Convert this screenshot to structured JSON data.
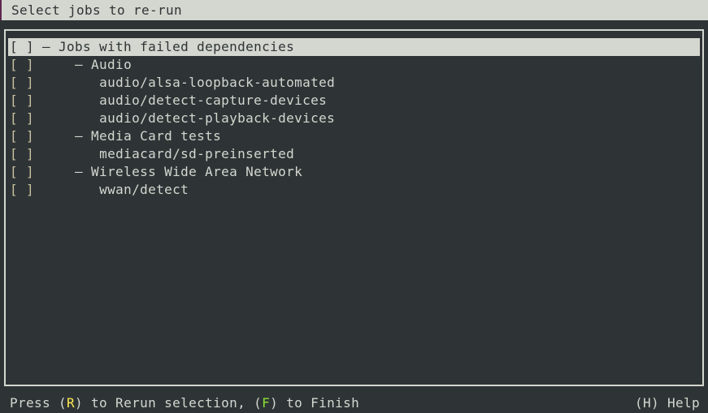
{
  "title": "Select jobs to re-run",
  "checkbox_label": "[ ]",
  "rows": [
    {
      "indent": "",
      "text": "– Jobs with failed dependencies",
      "selected": true
    },
    {
      "indent": "    ",
      "text": "– Audio"
    },
    {
      "indent": "       ",
      "text": "audio/alsa-loopback-automated"
    },
    {
      "indent": "       ",
      "text": "audio/detect-capture-devices"
    },
    {
      "indent": "       ",
      "text": "audio/detect-playback-devices"
    },
    {
      "indent": "    ",
      "text": "– Media Card tests"
    },
    {
      "indent": "       ",
      "text": "mediacard/sd-preinserted"
    },
    {
      "indent": "    ",
      "text": "– Wireless Wide Area Network"
    },
    {
      "indent": "       ",
      "text": "wwan/detect"
    }
  ],
  "footer": {
    "press": "Press (",
    "rerun_key": "R",
    "rerun_text": ") to Rerun selection, (",
    "finish_key": "F",
    "finish_text": ") to Finish",
    "help": "(H) Help"
  },
  "colors": {
    "background": "#2e3436",
    "highlight": "#d3d7cf",
    "rerun_key": "#fce94f",
    "finish_key": "#8ae234"
  }
}
